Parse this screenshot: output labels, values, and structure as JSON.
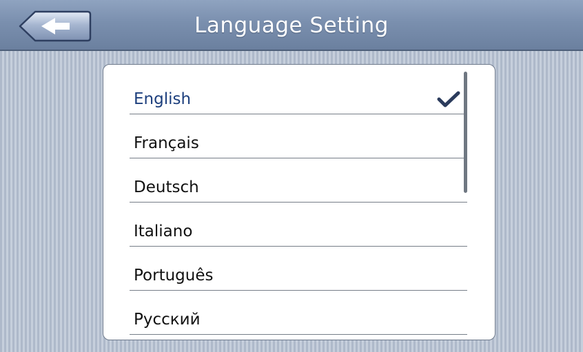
{
  "header": {
    "title": "Language Setting",
    "back_icon": "arrow-left-icon"
  },
  "languages": [
    {
      "label": "English",
      "selected": true
    },
    {
      "label": "Français",
      "selected": false
    },
    {
      "label": "Deutsch",
      "selected": false
    },
    {
      "label": "Italiano",
      "selected": false
    },
    {
      "label": "Português",
      "selected": false
    },
    {
      "label": "Русский",
      "selected": false
    }
  ],
  "selected_icon": "checkmark-icon",
  "colors": {
    "header": "#7a8fae",
    "selected_text": "#1d3f7d",
    "check": "#2b3b5c"
  }
}
